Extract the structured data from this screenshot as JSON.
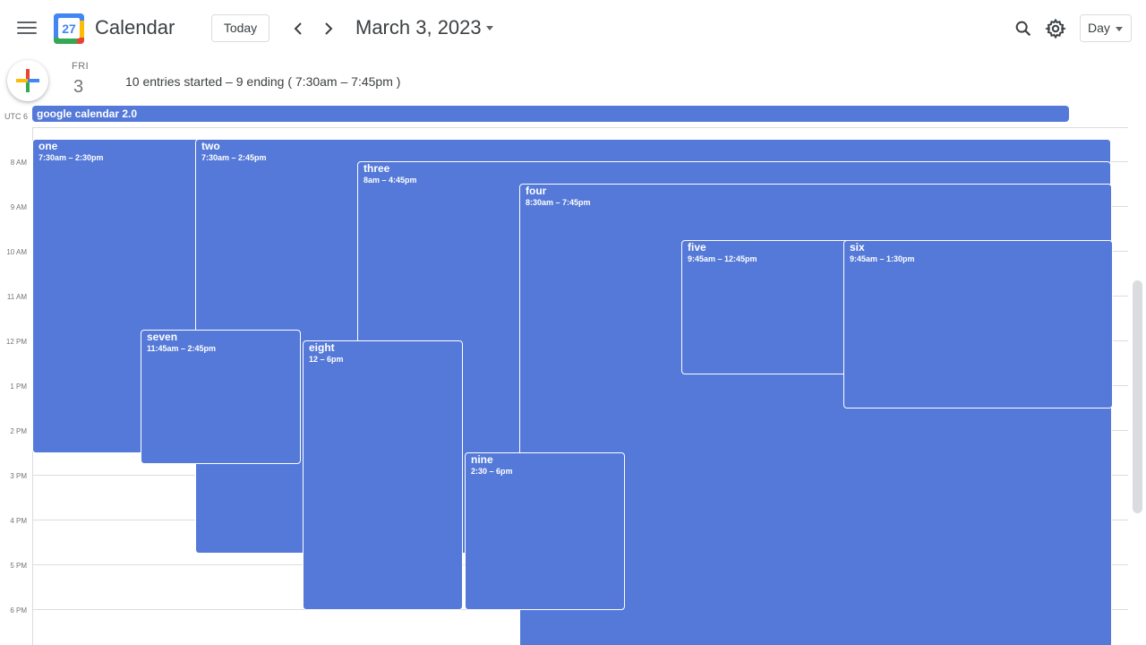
{
  "header": {
    "app_title": "Calendar",
    "logo_day": "27",
    "today_label": "Today",
    "date_title": "March 3, 2023",
    "view_label": "Day"
  },
  "day": {
    "name": "FRI",
    "number": "3",
    "summary": "10 entries started – 9 ending ( 7:30am – 7:45pm )"
  },
  "timezone": "UTC 6",
  "allday_event": {
    "name": "google calendar 2.0"
  },
  "hours": [
    "8 AM",
    "9 AM",
    "10 AM",
    "11 AM",
    "12 PM",
    "1 PM",
    "2 PM",
    "3 PM",
    "4 PM",
    "5 PM",
    "6 PM"
  ],
  "events": [
    {
      "name": "one",
      "time": "7:30am – 2:30pm"
    },
    {
      "name": "two",
      "time": "7:30am – 2:45pm"
    },
    {
      "name": "three",
      "time": "8am – 4:45pm"
    },
    {
      "name": "four",
      "time": "8:30am – 7:45pm"
    },
    {
      "name": "five",
      "time": "9:45am – 12:45pm"
    },
    {
      "name": "six",
      "time": "9:45am – 1:30pm"
    },
    {
      "name": "seven",
      "time": "11:45am – 2:45pm"
    },
    {
      "name": "eight",
      "time": "12 – 6pm"
    },
    {
      "name": "nine",
      "time": "2:30 – 6pm"
    }
  ],
  "colors": {
    "event": "#5579d8",
    "accent": "#4285f4"
  },
  "icons": {
    "menu": "hamburger-menu-icon",
    "prev": "chevron-left-icon",
    "next": "chevron-right-icon",
    "search": "search-icon",
    "settings": "gear-icon",
    "create": "plus-icon"
  }
}
